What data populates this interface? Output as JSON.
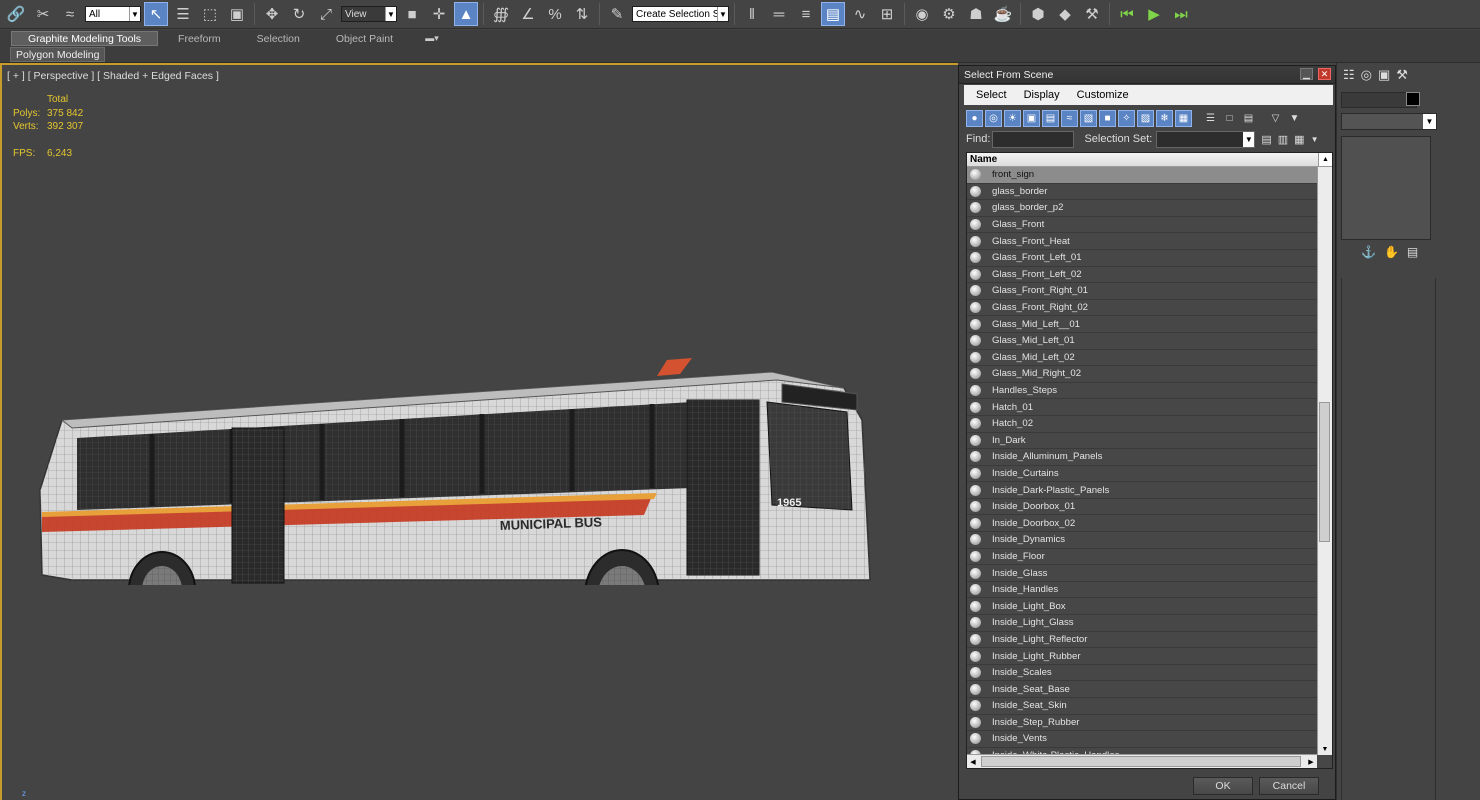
{
  "toolbar": {
    "filter_value": "All",
    "coord_value": "View",
    "selection_set_value": "Create Selection Se"
  },
  "ribbon": {
    "tabs": [
      "Graphite Modeling Tools",
      "Freeform",
      "Selection",
      "Object Paint"
    ],
    "panel_label": "Polygon Modeling"
  },
  "viewport": {
    "label": "[ + ] [ Perspective ] [ Shaded + Edged Faces ]",
    "stats": {
      "total_label": "Total",
      "polys_label": "Polys:",
      "polys_value": "375 842",
      "verts_label": "Verts:",
      "verts_value": "392 307",
      "fps_label": "FPS:",
      "fps_value": "6,243"
    },
    "bus_text": "MUNICIPAL BUS",
    "bus_number": "1965"
  },
  "dialog": {
    "title": "Select From Scene",
    "menu": [
      "Select",
      "Display",
      "Customize"
    ],
    "find_label": "Find:",
    "find_value": "",
    "selection_set_label": "Selection Set:",
    "column_header": "Name",
    "items": [
      "front_sign",
      "glass_border",
      "glass_border_p2",
      "Glass_Front",
      "Glass_Front_Heat",
      "Glass_Front_Left_01",
      "Glass_Front_Left_02",
      "Glass_Front_Right_01",
      "Glass_Front_Right_02",
      "Glass_Mid_Left__01",
      "Glass_Mid_Left_01",
      "Glass_Mid_Left_02",
      "Glass_Mid_Right_02",
      "Handles_Steps",
      "Hatch_01",
      "Hatch_02",
      "In_Dark",
      "Inside_Alluminum_Panels",
      "Inside_Curtains",
      "Inside_Dark-Plastic_Panels",
      "Inside_Doorbox_01",
      "Inside_Doorbox_02",
      "Inside_Dynamics",
      "Inside_Floor",
      "Inside_Glass",
      "Inside_Handles",
      "Inside_Light_Box",
      "Inside_Light_Glass",
      "Inside_Light_Reflector",
      "Inside_Light_Rubber",
      "Inside_Scales",
      "Inside_Seat_Base",
      "Inside_Seat_Skin",
      "Inside_Step_Rubber",
      "Inside_Vents",
      "Inside_White-Plastic_Handles"
    ],
    "selected_index": 0,
    "ok_label": "OK",
    "cancel_label": "Cancel"
  },
  "colors": {
    "viewport_border": "#c79c2a",
    "stats_text": "#e6c72e",
    "active_button": "#5a84c4"
  }
}
